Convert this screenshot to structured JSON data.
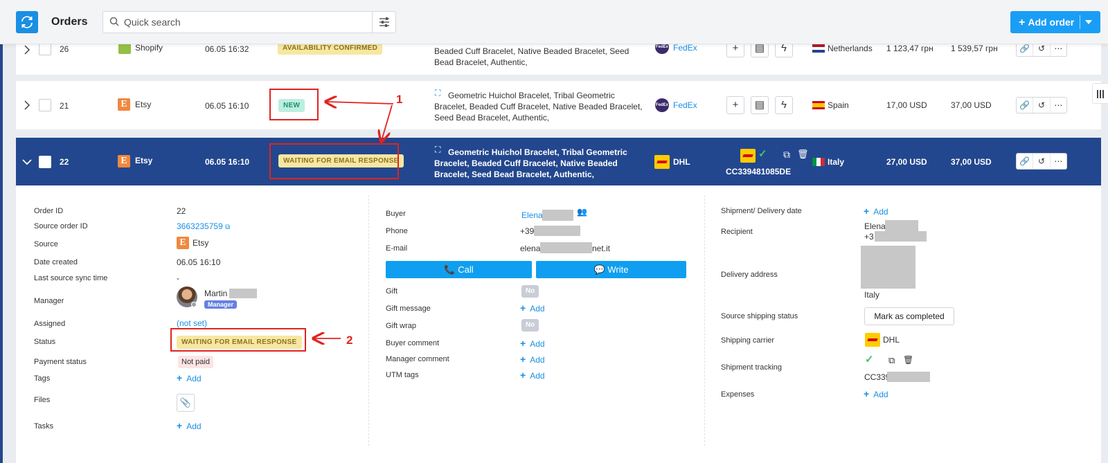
{
  "header": {
    "title": "Orders",
    "search_placeholder": "Quick search",
    "add_order_label": "Add order",
    "colors": {
      "accent": "#1a9ef5",
      "selected_row": "#23478e"
    }
  },
  "orders": [
    {
      "id": "26",
      "source": "Shopify",
      "date": "06.05 16:32",
      "status": "AVAILABILITY CONFIRMED",
      "items_text": "Beaded Cuff Bracelet, Native Beaded Bracelet, Seed Bead Bracelet, Authentic,",
      "carrier": "FedEx",
      "country": "Netherlands",
      "price1": "1 123,47 грн",
      "price2": "1 539,57 грн"
    },
    {
      "id": "21",
      "source": "Etsy",
      "date": "06.05 16:10",
      "status": "NEW",
      "items_text": "Geometric Huichol Bracelet, Tribal Geometric Bracelet, Beaded Cuff Bracelet, Native Beaded Bracelet, Seed Bead Bracelet, Authentic,",
      "carrier": "FedEx",
      "country": "Spain",
      "price1": "17,00 USD",
      "price2": "37,00 USD"
    },
    {
      "id": "22",
      "source": "Etsy",
      "date": "06.05 16:10",
      "status": "WAITING FOR EMAIL RESPONSE",
      "items_text": "Geometric Huichol Bracelet, Tribal Geometric Bracelet, Beaded Cuff Bracelet, Native Beaded Bracelet, Seed Bead Bracelet, Authentic,",
      "carrier": "DHL",
      "tracking": "CC339481085DE",
      "country": "Italy",
      "price1": "27,00 USD",
      "price2": "37,00 USD"
    }
  ],
  "annotations": {
    "one": "1",
    "two": "2"
  },
  "detail": {
    "left": {
      "order_id_label": "Order ID",
      "order_id": "22",
      "source_order_id_label": "Source order ID",
      "source_order_id": "3663235759",
      "source_label": "Source",
      "source": "Etsy",
      "date_created_label": "Date created",
      "date_created": "06.05 16:10",
      "last_sync_label": "Last source sync time",
      "last_sync": "-",
      "manager_label": "Manager",
      "manager_name": "Martin",
      "manager_badge": "Manager",
      "assigned_label": "Assigned",
      "assigned": "(not set)",
      "status_label": "Status",
      "status": "WAITING FOR EMAIL RESPONSE",
      "payment_label": "Payment status",
      "payment": "Not paid",
      "tags_label": "Tags",
      "files_label": "Files",
      "tasks_label": "Tasks",
      "add": "Add"
    },
    "middle": {
      "buyer_label": "Buyer",
      "buyer": "Elena",
      "phone_label": "Phone",
      "phone": "+39",
      "email_label": "E-mail",
      "email_prefix": "elena",
      "email_suffix": "net.it",
      "call": "Call",
      "write": "Write",
      "gift_label": "Gift",
      "gift": "No",
      "gift_message_label": "Gift message",
      "gift_wrap_label": "Gift wrap",
      "gift_wrap": "No",
      "buyer_comment_label": "Buyer comment",
      "manager_comment_label": "Manager comment",
      "utm_label": "UTM tags",
      "add": "Add"
    },
    "right": {
      "delivery_date_label": "Shipment/ Delivery date",
      "recipient_label": "Recipient",
      "recipient_name": "Elena",
      "recipient_phone": "+3",
      "address_label": "Delivery address",
      "address_country": "Italy",
      "source_shipping_label": "Source shipping status",
      "mark_completed": "Mark as completed",
      "carrier_label": "Shipping carrier",
      "carrier": "DHL",
      "tracking_label": "Shipment tracking",
      "tracking": "CC339",
      "expenses_label": "Expenses",
      "add": "Add"
    }
  }
}
